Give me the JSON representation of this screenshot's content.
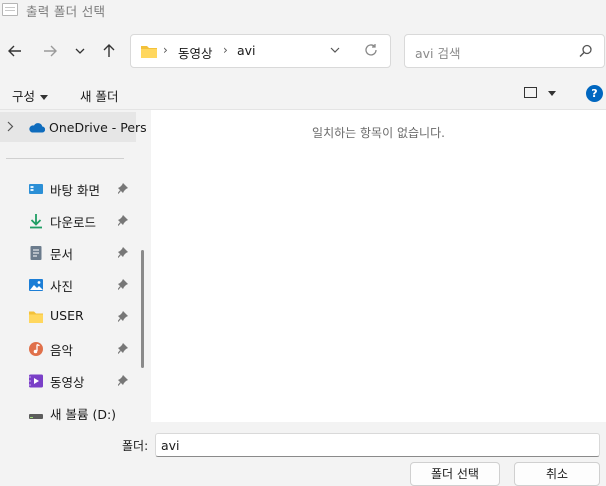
{
  "window": {
    "title": "출력 폴더 선택"
  },
  "address": {
    "segments": [
      "동영상",
      "avi"
    ]
  },
  "search": {
    "placeholder": "avi 검색"
  },
  "commands": {
    "organize": "구성",
    "new_folder": "새 폴더"
  },
  "sidebar": {
    "onedrive": "OneDrive - Pers",
    "items": [
      {
        "label": "바탕 화면",
        "icon": "desktop-icon"
      },
      {
        "label": "다운로드",
        "icon": "download-icon"
      },
      {
        "label": "문서",
        "icon": "document-icon"
      },
      {
        "label": "사진",
        "icon": "picture-icon"
      },
      {
        "label": "USER",
        "icon": "folder-icon"
      },
      {
        "label": "음악",
        "icon": "music-icon"
      },
      {
        "label": "동영상",
        "icon": "video-icon"
      },
      {
        "label": "새 볼륨 (D:)",
        "icon": "drive-icon"
      }
    ]
  },
  "content": {
    "empty_message": "일치하는 항목이 없습니다."
  },
  "footer": {
    "folder_label": "폴더:",
    "folder_value": "avi",
    "select_button": "폴더 선택",
    "cancel_button": "취소"
  },
  "colors": {
    "accent": "#0067c0",
    "folder_yellow": "#f3c13a"
  }
}
